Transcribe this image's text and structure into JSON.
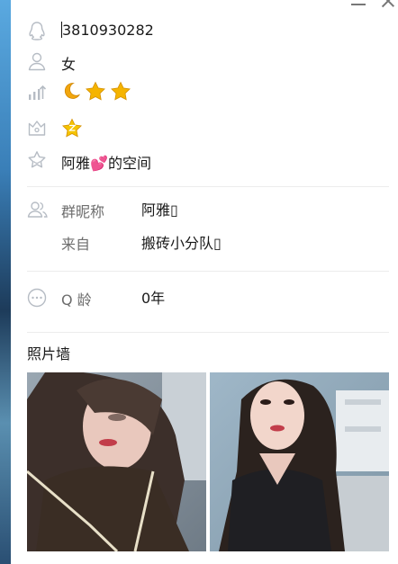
{
  "profile": {
    "qq_number": "3810930282",
    "gender": "女",
    "level_badges": [
      "moon",
      "star",
      "star"
    ],
    "vip_badge": "vip-star",
    "space_prefix": "阿雅",
    "space_emoji": "💕",
    "space_suffix": "的空间"
  },
  "group_info": {
    "nickname_label": "群昵称",
    "nickname_value": "阿雅▯",
    "from_label": "来自",
    "from_value": "搬砖小分队▯"
  },
  "qage": {
    "label": "Q 龄",
    "value": "0年"
  },
  "photo_wall": {
    "title": "照片墙"
  },
  "icons": {
    "qq": "qq-penguin-icon",
    "person": "person-icon",
    "level": "level-chart-icon",
    "vip": "crown-icon",
    "space": "star-outline-icon",
    "group": "group-people-icon",
    "more": "more-dots-icon"
  },
  "colors": {
    "icon_gray": "#b6bcc4",
    "label_gray": "#6d6d6d",
    "star_gold": "#f5b400",
    "moon_gold": "#f2a60d",
    "pink_emoji": "#ff5aa5"
  }
}
